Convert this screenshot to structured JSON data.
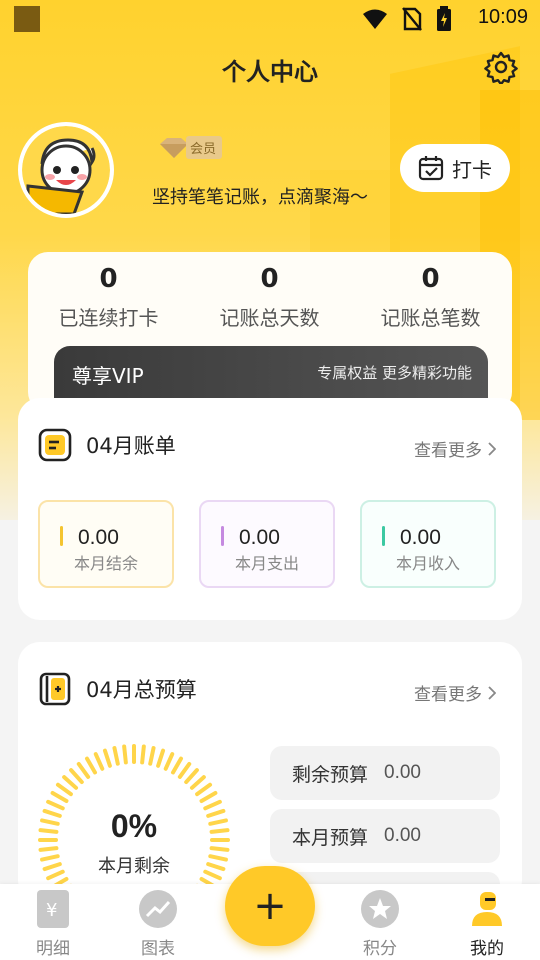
{
  "status_bar": {
    "time": "10:09"
  },
  "header": {
    "title": "个人中心"
  },
  "profile": {
    "vip_tag": "会员",
    "motto": "坚持笔笔记账，点滴聚海～",
    "checkin_label": "打卡"
  },
  "stats": [
    {
      "value": "0",
      "label": "已连续打卡"
    },
    {
      "value": "0",
      "label": "记账总天数"
    },
    {
      "value": "0",
      "label": "记账总笔数"
    }
  ],
  "vip_strip": {
    "title": "尊享VIP",
    "desc": "专属权益 更多精彩功能"
  },
  "bill": {
    "title": "04月账单",
    "more": "查看更多",
    "items": [
      {
        "value": "0.00",
        "label": "本月结余",
        "color": "#f4c430"
      },
      {
        "value": "0.00",
        "label": "本月支出",
        "color": "#c58ae0"
      },
      {
        "value": "0.00",
        "label": "本月收入",
        "color": "#3cc9a2"
      }
    ]
  },
  "budget": {
    "title": "04月总预算",
    "more": "查看更多",
    "percent_text": "0%",
    "percent_caption": "本月剩余",
    "rows": [
      {
        "label": "剩余预算",
        "value": "0.00"
      },
      {
        "label": "本月预算",
        "value": "0.00"
      }
    ]
  },
  "nav": {
    "items": [
      {
        "label": "明细",
        "icon": "ledger-icon"
      },
      {
        "label": "图表",
        "icon": "chart-icon"
      },
      {
        "label": "积分",
        "icon": "star-icon"
      },
      {
        "label": "我的",
        "icon": "profile-icon"
      }
    ],
    "add_label": "+"
  },
  "colors": {
    "accent": "#ffc928",
    "yellow_bg": "#ffd22e"
  }
}
